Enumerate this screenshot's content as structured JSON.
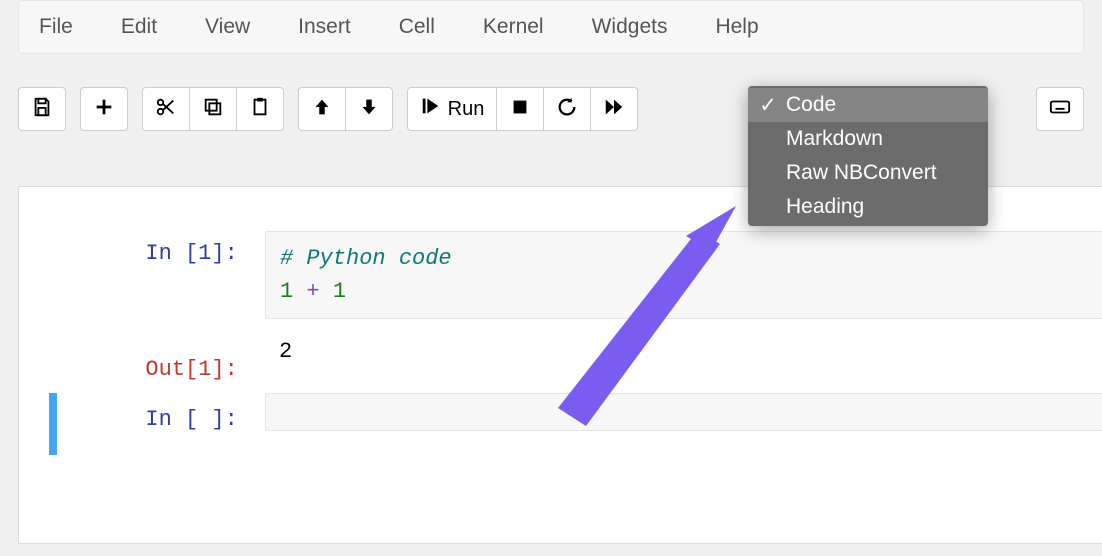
{
  "menu": {
    "file": "File",
    "edit": "Edit",
    "view": "View",
    "insert": "Insert",
    "cell": "Cell",
    "kernel": "Kernel",
    "widgets": "Widgets",
    "help": "Help"
  },
  "toolbar": {
    "run_label": "Run"
  },
  "celltype_dropdown": {
    "options": [
      "Code",
      "Markdown",
      "Raw NBConvert",
      "Heading"
    ],
    "selected": "Code"
  },
  "cells": {
    "c1_prompt": "In [1]: ",
    "c1_comment": "# Python code",
    "c1_num_a": "1",
    "c1_op": " + ",
    "c1_num_b": "1",
    "c1_out_prompt": "Out[1]: ",
    "c1_out_value": "2",
    "c2_prompt": "In [ ]: "
  },
  "colors": {
    "arrow": "#7B5CF0"
  }
}
